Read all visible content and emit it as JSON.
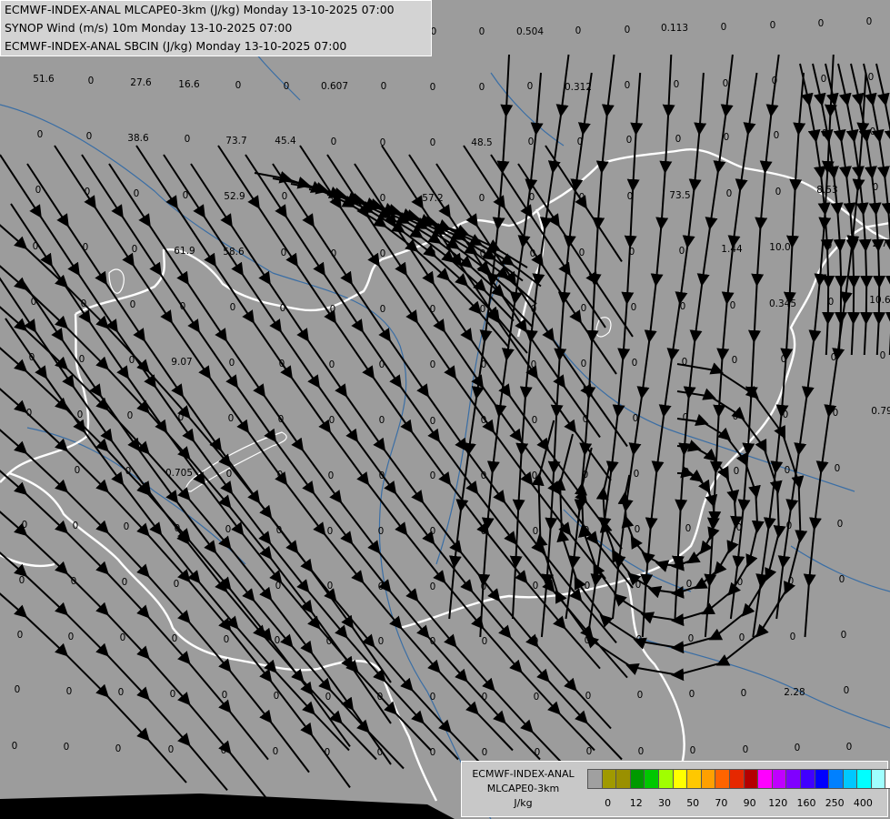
{
  "title_lines": [
    "ECMWF-INDEX-ANAL MLCAPE0-3km (J/kg) Monday 13-10-2025 07:00",
    "SYNOP Wind (m/s) 10m Monday 13-10-2025 07:00",
    "ECMWF-INDEX-ANAL SBCIN (J/kg) Monday 13-10-2025 07:00"
  ],
  "legend": {
    "title": [
      "ECMWF-INDEX-ANAL",
      "MLCAPE0-3km",
      "J/kg"
    ],
    "tick_labels": [
      "0",
      "12",
      "30",
      "50",
      "70",
      "90",
      "120",
      "160",
      "250",
      "400"
    ],
    "colors": [
      "#a0a0a0",
      "#a09a00",
      "#9a9000",
      "#009a00",
      "#00c800",
      "#a0ff00",
      "#ffff00",
      "#ffc800",
      "#ffa000",
      "#ff6400",
      "#e62800",
      "#b40000",
      "#ff00ff",
      "#c000ff",
      "#8000ff",
      "#4000ff",
      "#0000ff",
      "#0080ff",
      "#00c8ff",
      "#00ffff",
      "#a0ffff",
      "#ffffff"
    ]
  },
  "values": [
    {
      "v": "51.6",
      "c": [
        48,
        90
      ]
    },
    {
      "v": "0",
      "c": [
        100,
        92
      ]
    },
    {
      "v": "27.6",
      "c": [
        155,
        94
      ]
    },
    {
      "v": "16.6",
      "c": [
        208,
        96
      ]
    },
    {
      "v": "0",
      "c": [
        262,
        97
      ]
    },
    {
      "v": "0",
      "c": [
        315,
        98
      ]
    },
    {
      "v": "0.607",
      "c": [
        368,
        98
      ]
    },
    {
      "v": "0",
      "c": [
        422,
        98
      ]
    },
    {
      "v": "0",
      "c": [
        476,
        99
      ]
    },
    {
      "v": "0",
      "c": [
        530,
        99
      ]
    },
    {
      "v": "0",
      "c": [
        583,
        98
      ]
    },
    {
      "v": "0.312",
      "c": [
        636,
        99
      ]
    },
    {
      "v": "0",
      "c": [
        690,
        97
      ]
    },
    {
      "v": "0",
      "c": [
        744,
        96
      ]
    },
    {
      "v": "0",
      "c": [
        798,
        95
      ]
    },
    {
      "v": "0",
      "c": [
        852,
        92
      ]
    },
    {
      "v": "0",
      "c": [
        906,
        90
      ]
    },
    {
      "v": "0",
      "c": [
        958,
        88
      ]
    },
    {
      "v": "0",
      "c": [
        477,
        38
      ]
    },
    {
      "v": "0",
      "c": [
        530,
        38
      ]
    },
    {
      "v": "0.504",
      "c": [
        583,
        38
      ]
    },
    {
      "v": "0",
      "c": [
        636,
        37
      ]
    },
    {
      "v": "0",
      "c": [
        690,
        36
      ]
    },
    {
      "v": "0.113",
      "c": [
        742,
        34
      ]
    },
    {
      "v": "0",
      "c": [
        796,
        33
      ]
    },
    {
      "v": "0",
      "c": [
        850,
        31
      ]
    },
    {
      "v": "0",
      "c": [
        903,
        29
      ]
    },
    {
      "v": "0",
      "c": [
        956,
        27
      ]
    },
    {
      "v": "0",
      "c": [
        44,
        151
      ]
    },
    {
      "v": "0",
      "c": [
        98,
        153
      ]
    },
    {
      "v": "38.6",
      "c": [
        152,
        155
      ]
    },
    {
      "v": "0",
      "c": [
        206,
        156
      ]
    },
    {
      "v": "73.7",
      "c": [
        260,
        158
      ]
    },
    {
      "v": "45.4",
      "c": [
        314,
        158
      ]
    },
    {
      "v": "0",
      "c": [
        367,
        159
      ]
    },
    {
      "v": "0",
      "c": [
        421,
        160
      ]
    },
    {
      "v": "0",
      "c": [
        476,
        160
      ]
    },
    {
      "v": "48.5",
      "c": [
        530,
        160
      ]
    },
    {
      "v": "0",
      "c": [
        584,
        159
      ]
    },
    {
      "v": "0",
      "c": [
        638,
        159
      ]
    },
    {
      "v": "0",
      "c": [
        692,
        157
      ]
    },
    {
      "v": "0",
      "c": [
        746,
        156
      ]
    },
    {
      "v": "0",
      "c": [
        799,
        154
      ]
    },
    {
      "v": "0",
      "c": [
        854,
        152
      ]
    },
    {
      "v": "0",
      "c": [
        907,
        150
      ]
    },
    {
      "v": "0",
      "c": [
        960,
        148
      ]
    },
    {
      "v": "0",
      "c": [
        42,
        212
      ]
    },
    {
      "v": "0",
      "c": [
        96,
        214
      ]
    },
    {
      "v": "0",
      "c": [
        150,
        216
      ]
    },
    {
      "v": "0",
      "c": [
        204,
        218
      ]
    },
    {
      "v": "52.9",
      "c": [
        258,
        219
      ]
    },
    {
      "v": "0",
      "c": [
        313,
        219
      ]
    },
    {
      "v": "0",
      "c": [
        367,
        220
      ]
    },
    {
      "v": "0",
      "c": [
        421,
        221
      ]
    },
    {
      "v": "57.2",
      "c": [
        476,
        221
      ]
    },
    {
      "v": "0",
      "c": [
        530,
        221
      ]
    },
    {
      "v": "0",
      "c": [
        585,
        220
      ]
    },
    {
      "v": "0",
      "c": [
        640,
        220
      ]
    },
    {
      "v": "0",
      "c": [
        693,
        219
      ]
    },
    {
      "v": "73.5",
      "c": [
        748,
        218
      ]
    },
    {
      "v": "0",
      "c": [
        802,
        216
      ]
    },
    {
      "v": "0",
      "c": [
        856,
        214
      ]
    },
    {
      "v": "8.53",
      "c": [
        910,
        212
      ]
    },
    {
      "v": "0",
      "c": [
        963,
        209
      ]
    },
    {
      "v": "0",
      "c": [
        39,
        274
      ]
    },
    {
      "v": "0",
      "c": [
        94,
        275
      ]
    },
    {
      "v": "0",
      "c": [
        148,
        277
      ]
    },
    {
      "v": "61.9",
      "c": [
        203,
        279
      ]
    },
    {
      "v": "58.6",
      "c": [
        257,
        280
      ]
    },
    {
      "v": "0",
      "c": [
        312,
        281
      ]
    },
    {
      "v": "0",
      "c": [
        367,
        282
      ]
    },
    {
      "v": "0",
      "c": [
        421,
        282
      ]
    },
    {
      "v": "0",
      "c": [
        476,
        282
      ]
    },
    {
      "v": "0",
      "c": [
        531,
        282
      ]
    },
    {
      "v": "0",
      "c": [
        586,
        282
      ]
    },
    {
      "v": "0",
      "c": [
        640,
        281
      ]
    },
    {
      "v": "0",
      "c": [
        695,
        280
      ]
    },
    {
      "v": "0",
      "c": [
        750,
        279
      ]
    },
    {
      "v": "1.44",
      "c": [
        805,
        277
      ]
    },
    {
      "v": "10.0",
      "c": [
        858,
        275
      ]
    },
    {
      "v": "0",
      "c": [
        912,
        273
      ]
    },
    {
      "v": "2.7",
      "c": [
        968,
        271
      ]
    },
    {
      "v": "0",
      "c": [
        37,
        335
      ]
    },
    {
      "v": "0",
      "c": [
        92,
        337
      ]
    },
    {
      "v": "0",
      "c": [
        146,
        338
      ]
    },
    {
      "v": "0",
      "c": [
        201,
        340
      ]
    },
    {
      "v": "0",
      "c": [
        256,
        341
      ]
    },
    {
      "v": "0",
      "c": [
        311,
        342
      ]
    },
    {
      "v": "0",
      "c": [
        366,
        343
      ]
    },
    {
      "v": "0",
      "c": [
        421,
        343
      ]
    },
    {
      "v": "0",
      "c": [
        476,
        343
      ]
    },
    {
      "v": "0",
      "c": [
        531,
        343
      ]
    },
    {
      "v": "0",
      "c": [
        587,
        343
      ]
    },
    {
      "v": "0",
      "c": [
        642,
        342
      ]
    },
    {
      "v": "0",
      "c": [
        697,
        341
      ]
    },
    {
      "v": "0",
      "c": [
        751,
        340
      ]
    },
    {
      "v": "0",
      "c": [
        806,
        339
      ]
    },
    {
      "v": "0.345",
      "c": [
        861,
        337
      ]
    },
    {
      "v": "0",
      "c": [
        914,
        335
      ]
    },
    {
      "v": "10.6",
      "c": [
        968,
        333
      ]
    },
    {
      "v": "0",
      "c": [
        35,
        396
      ]
    },
    {
      "v": "0",
      "c": [
        90,
        398
      ]
    },
    {
      "v": "0",
      "c": [
        145,
        399
      ]
    },
    {
      "v": "9.07",
      "c": [
        200,
        401
      ]
    },
    {
      "v": "0",
      "c": [
        255,
        402
      ]
    },
    {
      "v": "0",
      "c": [
        310,
        403
      ]
    },
    {
      "v": "0",
      "c": [
        365,
        404
      ]
    },
    {
      "v": "0",
      "c": [
        420,
        404
      ]
    },
    {
      "v": "0",
      "c": [
        476,
        404
      ]
    },
    {
      "v": "0",
      "c": [
        532,
        404
      ]
    },
    {
      "v": "0",
      "c": [
        587,
        404
      ]
    },
    {
      "v": "0",
      "c": [
        642,
        403
      ]
    },
    {
      "v": "0",
      "c": [
        698,
        402
      ]
    },
    {
      "v": "0",
      "c": [
        753,
        401
      ]
    },
    {
      "v": "0",
      "c": [
        808,
        399
      ]
    },
    {
      "v": "0",
      "c": [
        862,
        398
      ]
    },
    {
      "v": "0",
      "c": [
        917,
        396
      ]
    },
    {
      "v": "0",
      "c": [
        971,
        394
      ]
    },
    {
      "v": "0",
      "c": [
        32,
        457
      ]
    },
    {
      "v": "0",
      "c": [
        88,
        459
      ]
    },
    {
      "v": "0",
      "c": [
        143,
        460
      ]
    },
    {
      "v": "0",
      "c": [
        199,
        462
      ]
    },
    {
      "v": "0",
      "c": [
        254,
        463
      ]
    },
    {
      "v": "0",
      "c": [
        309,
        464
      ]
    },
    {
      "v": "0",
      "c": [
        365,
        465
      ]
    },
    {
      "v": "0",
      "c": [
        420,
        465
      ]
    },
    {
      "v": "0",
      "c": [
        476,
        466
      ]
    },
    {
      "v": "0",
      "c": [
        532,
        465
      ]
    },
    {
      "v": "0",
      "c": [
        588,
        465
      ]
    },
    {
      "v": "0",
      "c": [
        644,
        464
      ]
    },
    {
      "v": "0",
      "c": [
        699,
        463
      ]
    },
    {
      "v": "0",
      "c": [
        754,
        462
      ]
    },
    {
      "v": "0",
      "c": [
        809,
        461
      ]
    },
    {
      "v": "0",
      "c": [
        864,
        459
      ]
    },
    {
      "v": "0",
      "c": [
        919,
        457
      ]
    },
    {
      "v": "0.79",
      "c": [
        970,
        455
      ]
    },
    {
      "v": "0",
      "c": [
        85,
        520
      ]
    },
    {
      "v": "0",
      "c": [
        141,
        521
      ]
    },
    {
      "v": "0.705",
      "c": [
        197,
        523
      ]
    },
    {
      "v": "0",
      "c": [
        252,
        524
      ]
    },
    {
      "v": "0",
      "c": [
        308,
        525
      ]
    },
    {
      "v": "0",
      "c": [
        364,
        526
      ]
    },
    {
      "v": "0",
      "c": [
        420,
        526
      ]
    },
    {
      "v": "0",
      "c": [
        476,
        526
      ]
    },
    {
      "v": "0",
      "c": [
        532,
        526
      ]
    },
    {
      "v": "0",
      "c": [
        588,
        526
      ]
    },
    {
      "v": "0",
      "c": [
        644,
        525
      ]
    },
    {
      "v": "0",
      "c": [
        700,
        524
      ]
    },
    {
      "v": "0",
      "c": [
        755,
        522
      ]
    },
    {
      "v": "0",
      "c": [
        810,
        521
      ]
    },
    {
      "v": "0",
      "c": [
        866,
        520
      ]
    },
    {
      "v": "0",
      "c": [
        921,
        518
      ]
    },
    {
      "v": "0",
      "c": [
        27,
        580
      ]
    },
    {
      "v": "0",
      "c": [
        83,
        581
      ]
    },
    {
      "v": "0",
      "c": [
        139,
        582
      ]
    },
    {
      "v": "0",
      "c": [
        195,
        584
      ]
    },
    {
      "v": "0",
      "c": [
        251,
        585
      ]
    },
    {
      "v": "0",
      "c": [
        307,
        586
      ]
    },
    {
      "v": "0",
      "c": [
        363,
        587
      ]
    },
    {
      "v": "0",
      "c": [
        419,
        587
      ]
    },
    {
      "v": "0",
      "c": [
        476,
        587
      ]
    },
    {
      "v": "0",
      "c": [
        532,
        587
      ]
    },
    {
      "v": "0",
      "c": [
        589,
        587
      ]
    },
    {
      "v": "0",
      "c": [
        645,
        586
      ]
    },
    {
      "v": "0",
      "c": [
        701,
        585
      ]
    },
    {
      "v": "0",
      "c": [
        757,
        584
      ]
    },
    {
      "v": "0",
      "c": [
        813,
        583
      ]
    },
    {
      "v": "0",
      "c": [
        868,
        581
      ]
    },
    {
      "v": "0",
      "c": [
        924,
        579
      ]
    },
    {
      "v": "0",
      "c": [
        24,
        641
      ]
    },
    {
      "v": "0",
      "c": [
        81,
        642
      ]
    },
    {
      "v": "0",
      "c": [
        137,
        643
      ]
    },
    {
      "v": "0",
      "c": [
        194,
        645
      ]
    },
    {
      "v": "0",
      "c": [
        250,
        646
      ]
    },
    {
      "v": "0",
      "c": [
        306,
        647
      ]
    },
    {
      "v": "0",
      "c": [
        363,
        647
      ]
    },
    {
      "v": "0",
      "c": [
        419,
        648
      ]
    },
    {
      "v": "0",
      "c": [
        476,
        648
      ]
    },
    {
      "v": "0",
      "c": [
        532,
        648
      ]
    },
    {
      "v": "0",
      "c": [
        589,
        647
      ]
    },
    {
      "v": "0",
      "c": [
        646,
        647
      ]
    },
    {
      "v": "0",
      "c": [
        702,
        646
      ]
    },
    {
      "v": "0",
      "c": [
        758,
        645
      ]
    },
    {
      "v": "0",
      "c": [
        814,
        643
      ]
    },
    {
      "v": "0",
      "c": [
        870,
        642
      ]
    },
    {
      "v": "0",
      "c": [
        926,
        640
      ]
    },
    {
      "v": "0",
      "c": [
        22,
        701
      ]
    },
    {
      "v": "0",
      "c": [
        78,
        703
      ]
    },
    {
      "v": "0",
      "c": [
        135,
        704
      ]
    },
    {
      "v": "0",
      "c": [
        192,
        705
      ]
    },
    {
      "v": "0",
      "c": [
        249,
        706
      ]
    },
    {
      "v": "0",
      "c": [
        305,
        707
      ]
    },
    {
      "v": "0",
      "c": [
        362,
        708
      ]
    },
    {
      "v": "0",
      "c": [
        419,
        708
      ]
    },
    {
      "v": "0",
      "c": [
        476,
        708
      ]
    },
    {
      "v": "0",
      "c": [
        533,
        708
      ]
    },
    {
      "v": "0",
      "c": [
        589,
        708
      ]
    },
    {
      "v": "0",
      "c": [
        646,
        707
      ]
    },
    {
      "v": "0",
      "c": [
        703,
        706
      ]
    },
    {
      "v": "0",
      "c": [
        760,
        705
      ]
    },
    {
      "v": "0",
      "c": [
        816,
        704
      ]
    },
    {
      "v": "0",
      "c": [
        872,
        703
      ]
    },
    {
      "v": "0",
      "c": [
        928,
        701
      ]
    },
    {
      "v": "0",
      "c": [
        19,
        761
      ]
    },
    {
      "v": "0",
      "c": [
        76,
        763
      ]
    },
    {
      "v": "0",
      "c": [
        133,
        764
      ]
    },
    {
      "v": "0",
      "c": [
        190,
        766
      ]
    },
    {
      "v": "0",
      "c": [
        247,
        767
      ]
    },
    {
      "v": "0",
      "c": [
        304,
        768
      ]
    },
    {
      "v": "0",
      "c": [
        361,
        769
      ]
    },
    {
      "v": "0",
      "c": [
        418,
        769
      ]
    },
    {
      "v": "0",
      "c": [
        476,
        769
      ]
    },
    {
      "v": "0",
      "c": [
        533,
        769
      ]
    },
    {
      "v": "0",
      "c": [
        590,
        769
      ]
    },
    {
      "v": "0",
      "c": [
        647,
        768
      ]
    },
    {
      "v": "0",
      "c": [
        704,
        767
      ]
    },
    {
      "v": "0",
      "c": [
        761,
        766
      ]
    },
    {
      "v": "0",
      "c": [
        818,
        765
      ]
    },
    {
      "v": "2.28",
      "c": [
        874,
        764
      ]
    },
    {
      "v": "0",
      "c": [
        931,
        762
      ]
    },
    {
      "v": "0",
      "c": [
        16,
        823
      ]
    },
    {
      "v": "0",
      "c": [
        73,
        824
      ]
    },
    {
      "v": "0",
      "c": [
        130,
        826
      ]
    },
    {
      "v": "0",
      "c": [
        188,
        827
      ]
    },
    {
      "v": "0",
      "c": [
        246,
        828
      ]
    },
    {
      "v": "0",
      "c": [
        303,
        829
      ]
    },
    {
      "v": "0",
      "c": [
        360,
        830
      ]
    },
    {
      "v": "0",
      "c": [
        418,
        830
      ]
    },
    {
      "v": "0",
      "c": [
        476,
        830
      ]
    },
    {
      "v": "0",
      "c": [
        533,
        830
      ]
    },
    {
      "v": "0",
      "c": [
        591,
        830
      ]
    },
    {
      "v": "0",
      "c": [
        648,
        829
      ]
    },
    {
      "v": "0",
      "c": [
        705,
        829
      ]
    },
    {
      "v": "0",
      "c": [
        762,
        828
      ]
    },
    {
      "v": "0",
      "c": [
        820,
        827
      ]
    },
    {
      "v": "0",
      "c": [
        877,
        825
      ]
    },
    {
      "v": "0",
      "c": [
        934,
        824
      ]
    }
  ]
}
